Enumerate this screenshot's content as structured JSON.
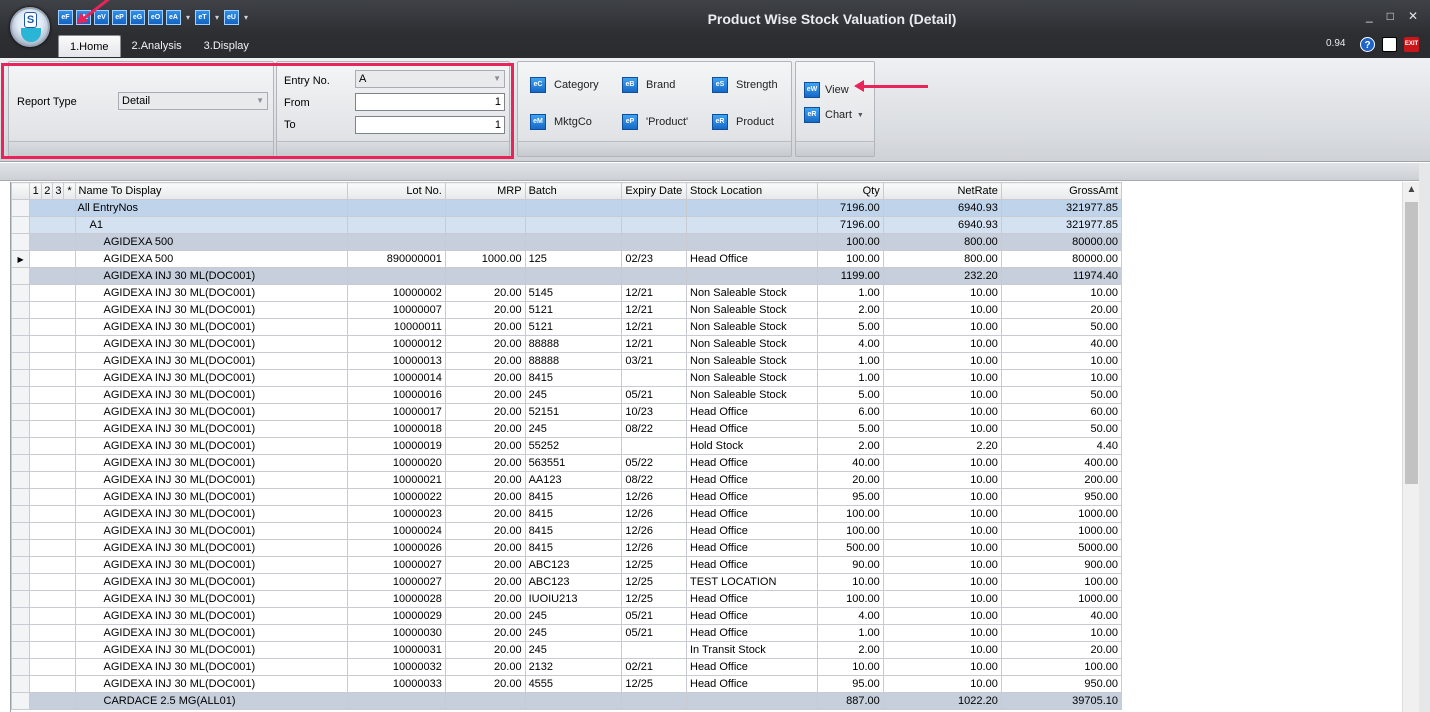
{
  "window": {
    "title": "Product Wise Stock Valuation (Detail)",
    "version": "0.94",
    "minimize": "_",
    "maximize": "□",
    "close": "✕",
    "logo_letter": "S",
    "help_glyph": "?",
    "exit_text": "EXIT"
  },
  "quick_access": [
    {
      "label": "eF",
      "icon": "quick-f-icon"
    },
    {
      "label": "eN",
      "icon": "quick-n-icon"
    },
    {
      "label": "eV",
      "icon": "quick-v-icon"
    },
    {
      "label": "eP",
      "icon": "quick-p-icon"
    },
    {
      "label": "eG",
      "icon": "quick-g-icon"
    },
    {
      "label": "eO",
      "icon": "quick-o-icon"
    },
    {
      "label": "eA",
      "icon": "quick-a-icon"
    },
    {
      "label": "eT",
      "icon": "quick-t-icon"
    },
    {
      "label": "eU",
      "icon": "quick-u-icon"
    }
  ],
  "tabs": [
    "1.Home",
    "2.Analysis",
    "3.Display"
  ],
  "ribbon": {
    "report_type_label": "Report Type",
    "report_type_value": "Detail",
    "entry_no_label": "Entry No.",
    "entry_no_value": "A",
    "from_label": "From",
    "from_value": "1",
    "to_label": "To",
    "to_value": "1",
    "filters": {
      "category": "Category",
      "brand": "Brand",
      "strength": "Strength",
      "mktgco": "MktgCo",
      "product_quoted": "'Product'",
      "product": "Product"
    },
    "filter_icons": {
      "category": "eC",
      "brand": "eB",
      "strength": "eS",
      "mktgco": "eM",
      "product_quoted": "eP",
      "product": "eR"
    },
    "view_label": "View",
    "view_icon": "eW",
    "chart_label": "Chart",
    "chart_icon": "eR"
  },
  "grid": {
    "levels": [
      "1",
      "2",
      "3",
      "*"
    ],
    "headers": [
      "Name To Display",
      "Lot No.",
      "MRP",
      "Batch",
      "Expiry Date",
      "Stock Location",
      "Qty",
      "NetRate",
      "GrossAmt"
    ],
    "rows": [
      {
        "type": "g0",
        "indent": 0,
        "name": "All EntryNos",
        "lot": "",
        "mrp": "",
        "batch": "",
        "expiry": "",
        "location": "",
        "qty": "7196.00",
        "rate": "6940.93",
        "gross": "321977.85"
      },
      {
        "type": "g1",
        "indent": 1,
        "name": "A1",
        "lot": "",
        "mrp": "",
        "batch": "",
        "expiry": "",
        "location": "",
        "qty": "7196.00",
        "rate": "6940.93",
        "gross": "321977.85"
      },
      {
        "type": "g2",
        "indent": 2,
        "name": "AGIDEXA 500",
        "lot": "",
        "mrp": "",
        "batch": "",
        "expiry": "",
        "location": "",
        "qty": "100.00",
        "rate": "800.00",
        "gross": "80000.00"
      },
      {
        "type": "d",
        "indent": 2,
        "current": true,
        "name": "AGIDEXA 500",
        "lot": "890000001",
        "mrp": "1000.00",
        "batch": "125",
        "expiry": "02/23",
        "location": "Head Office",
        "qty": "100.00",
        "rate": "800.00",
        "gross": "80000.00"
      },
      {
        "type": "g2",
        "indent": 2,
        "name": "AGIDEXA INJ 30 ML(DOC001)",
        "lot": "",
        "mrp": "",
        "batch": "",
        "expiry": "",
        "location": "",
        "qty": "1199.00",
        "rate": "232.20",
        "gross": "11974.40"
      },
      {
        "type": "d",
        "indent": 2,
        "name": "AGIDEXA INJ 30 ML(DOC001)",
        "lot": "10000002",
        "mrp": "20.00",
        "batch": "5145",
        "expiry": "12/21",
        "location": "Non Saleable Stock",
        "qty": "1.00",
        "rate": "10.00",
        "gross": "10.00"
      },
      {
        "type": "d",
        "indent": 2,
        "name": "AGIDEXA INJ 30 ML(DOC001)",
        "lot": "10000007",
        "mrp": "20.00",
        "batch": "5121",
        "expiry": "12/21",
        "location": "Non Saleable Stock",
        "qty": "2.00",
        "rate": "10.00",
        "gross": "20.00"
      },
      {
        "type": "d",
        "indent": 2,
        "name": "AGIDEXA INJ 30 ML(DOC001)",
        "lot": "10000011",
        "mrp": "20.00",
        "batch": "5121",
        "expiry": "12/21",
        "location": "Non Saleable Stock",
        "qty": "5.00",
        "rate": "10.00",
        "gross": "50.00"
      },
      {
        "type": "d",
        "indent": 2,
        "name": "AGIDEXA INJ 30 ML(DOC001)",
        "lot": "10000012",
        "mrp": "20.00",
        "batch": "88888",
        "expiry": "12/21",
        "location": "Non Saleable Stock",
        "qty": "4.00",
        "rate": "10.00",
        "gross": "40.00"
      },
      {
        "type": "d",
        "indent": 2,
        "name": "AGIDEXA INJ 30 ML(DOC001)",
        "lot": "10000013",
        "mrp": "20.00",
        "batch": "88888",
        "expiry": "03/21",
        "location": "Non Saleable Stock",
        "qty": "1.00",
        "rate": "10.00",
        "gross": "10.00"
      },
      {
        "type": "d",
        "indent": 2,
        "name": "AGIDEXA INJ 30 ML(DOC001)",
        "lot": "10000014",
        "mrp": "20.00",
        "batch": "8415",
        "expiry": "",
        "location": "Non Saleable Stock",
        "qty": "1.00",
        "rate": "10.00",
        "gross": "10.00"
      },
      {
        "type": "d",
        "indent": 2,
        "name": "AGIDEXA INJ 30 ML(DOC001)",
        "lot": "10000016",
        "mrp": "20.00",
        "batch": "245",
        "expiry": "05/21",
        "location": "Non Saleable Stock",
        "qty": "5.00",
        "rate": "10.00",
        "gross": "50.00"
      },
      {
        "type": "d",
        "indent": 2,
        "name": "AGIDEXA INJ 30 ML(DOC001)",
        "lot": "10000017",
        "mrp": "20.00",
        "batch": "52151",
        "expiry": "10/23",
        "location": "Head Office",
        "qty": "6.00",
        "rate": "10.00",
        "gross": "60.00"
      },
      {
        "type": "d",
        "indent": 2,
        "name": "AGIDEXA INJ 30 ML(DOC001)",
        "lot": "10000018",
        "mrp": "20.00",
        "batch": "245",
        "expiry": "08/22",
        "location": "Head Office",
        "qty": "5.00",
        "rate": "10.00",
        "gross": "50.00"
      },
      {
        "type": "d",
        "indent": 2,
        "name": "AGIDEXA INJ 30 ML(DOC001)",
        "lot": "10000019",
        "mrp": "20.00",
        "batch": "55252",
        "expiry": "",
        "location": "Hold Stock",
        "qty": "2.00",
        "rate": "2.20",
        "gross": "4.40"
      },
      {
        "type": "d",
        "indent": 2,
        "name": "AGIDEXA INJ 30 ML(DOC001)",
        "lot": "10000020",
        "mrp": "20.00",
        "batch": "563551",
        "expiry": "05/22",
        "location": "Head Office",
        "qty": "40.00",
        "rate": "10.00",
        "gross": "400.00"
      },
      {
        "type": "d",
        "indent": 2,
        "name": "AGIDEXA INJ 30 ML(DOC001)",
        "lot": "10000021",
        "mrp": "20.00",
        "batch": "AA123",
        "expiry": "08/22",
        "location": "Head Office",
        "qty": "20.00",
        "rate": "10.00",
        "gross": "200.00"
      },
      {
        "type": "d",
        "indent": 2,
        "name": "AGIDEXA INJ 30 ML(DOC001)",
        "lot": "10000022",
        "mrp": "20.00",
        "batch": "8415",
        "expiry": "12/26",
        "location": "Head Office",
        "qty": "95.00",
        "rate": "10.00",
        "gross": "950.00"
      },
      {
        "type": "d",
        "indent": 2,
        "name": "AGIDEXA INJ 30 ML(DOC001)",
        "lot": "10000023",
        "mrp": "20.00",
        "batch": "8415",
        "expiry": "12/26",
        "location": "Head Office",
        "qty": "100.00",
        "rate": "10.00",
        "gross": "1000.00"
      },
      {
        "type": "d",
        "indent": 2,
        "name": "AGIDEXA INJ 30 ML(DOC001)",
        "lot": "10000024",
        "mrp": "20.00",
        "batch": "8415",
        "expiry": "12/26",
        "location": "Head Office",
        "qty": "100.00",
        "rate": "10.00",
        "gross": "1000.00"
      },
      {
        "type": "d",
        "indent": 2,
        "name": "AGIDEXA INJ 30 ML(DOC001)",
        "lot": "10000026",
        "mrp": "20.00",
        "batch": "8415",
        "expiry": "12/26",
        "location": "Head Office",
        "qty": "500.00",
        "rate": "10.00",
        "gross": "5000.00"
      },
      {
        "type": "d",
        "indent": 2,
        "name": "AGIDEXA INJ 30 ML(DOC001)",
        "lot": "10000027",
        "mrp": "20.00",
        "batch": "ABC123",
        "expiry": "12/25",
        "location": "Head Office",
        "qty": "90.00",
        "rate": "10.00",
        "gross": "900.00"
      },
      {
        "type": "d",
        "indent": 2,
        "name": "AGIDEXA INJ 30 ML(DOC001)",
        "lot": "10000027",
        "mrp": "20.00",
        "batch": "ABC123",
        "expiry": "12/25",
        "location": "TEST LOCATION",
        "qty": "10.00",
        "rate": "10.00",
        "gross": "100.00"
      },
      {
        "type": "d",
        "indent": 2,
        "name": "AGIDEXA INJ 30 ML(DOC001)",
        "lot": "10000028",
        "mrp": "20.00",
        "batch": "IUOIU213",
        "expiry": "12/25",
        "location": "Head Office",
        "qty": "100.00",
        "rate": "10.00",
        "gross": "1000.00"
      },
      {
        "type": "d",
        "indent": 2,
        "name": "AGIDEXA INJ 30 ML(DOC001)",
        "lot": "10000029",
        "mrp": "20.00",
        "batch": "245",
        "expiry": "05/21",
        "location": "Head Office",
        "qty": "4.00",
        "rate": "10.00",
        "gross": "40.00"
      },
      {
        "type": "d",
        "indent": 2,
        "name": "AGIDEXA INJ 30 ML(DOC001)",
        "lot": "10000030",
        "mrp": "20.00",
        "batch": "245",
        "expiry": "05/21",
        "location": "Head Office",
        "qty": "1.00",
        "rate": "10.00",
        "gross": "10.00"
      },
      {
        "type": "d",
        "indent": 2,
        "name": "AGIDEXA INJ 30 ML(DOC001)",
        "lot": "10000031",
        "mrp": "20.00",
        "batch": "245",
        "expiry": "",
        "location": "In Transit Stock",
        "qty": "2.00",
        "rate": "10.00",
        "gross": "20.00"
      },
      {
        "type": "d",
        "indent": 2,
        "name": "AGIDEXA INJ 30 ML(DOC001)",
        "lot": "10000032",
        "mrp": "20.00",
        "batch": "2132",
        "expiry": "02/21",
        "location": "Head Office",
        "qty": "10.00",
        "rate": "10.00",
        "gross": "100.00"
      },
      {
        "type": "d",
        "indent": 2,
        "name": "AGIDEXA INJ 30 ML(DOC001)",
        "lot": "10000033",
        "mrp": "20.00",
        "batch": "4555",
        "expiry": "12/25",
        "location": "Head Office",
        "qty": "95.00",
        "rate": "10.00",
        "gross": "950.00"
      },
      {
        "type": "g2",
        "indent": 2,
        "name": "CARDACE 2.5 MG(ALL01)",
        "lot": "",
        "mrp": "",
        "batch": "",
        "expiry": "",
        "location": "",
        "qty": "887.00",
        "rate": "1022.20",
        "gross": "39705.10"
      }
    ]
  },
  "colors": {
    "highlight": "#e8245a",
    "group_level0": "#bfd3ea",
    "group_level1": "#d4e1f1",
    "group_level2": "#c6cfdb"
  }
}
